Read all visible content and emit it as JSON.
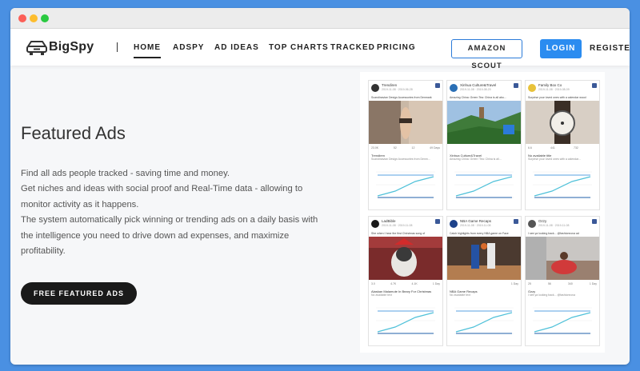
{
  "brand": {
    "name": "BigSpy"
  },
  "nav": {
    "items": [
      "HOME",
      "ADSPY",
      "AD IDEAS",
      "TOP CHARTS",
      "TRACKED",
      "PRICING"
    ],
    "active": "HOME",
    "amazon_label": "AMAZON SCOUT",
    "login_label": "LOGIN",
    "register_label": "REGISTER"
  },
  "hero": {
    "title": "Featured Ads",
    "desc": [
      "Find all ads people tracked - saving time and money.",
      "Get niches and ideas with social proof and Real-Time data - allowing to monitor activity as it happens.",
      "The system automatically pick winning or trending ads on a daily basis with the intelligence you need to drive down ad expenses, and maximize profitability."
    ],
    "cta_label": "FREE FEATURED ADS"
  },
  "cards": [
    {
      "name": "Trendiren",
      "date": "2019-11-08 · 2019-06-28",
      "caption": "Scandinavian Design Accessories from Denmark",
      "stats": [
        "23.0K",
        "52",
        "12",
        "49 Days"
      ],
      "title2": "Trendiren",
      "text2": "Scandinavian Design Accessories from Denm...",
      "scene": "bracelet",
      "av": "#333333"
    },
    {
      "name": "Xinhua Culture&Travel",
      "date": "2019-11-08 · 2019-08-20",
      "caption": "Amazing China: Green Tea: China is all abo...",
      "stats": [
        "",
        "",
        "",
        ""
      ],
      "title2": "Xinhua Culture&Travel",
      "text2": "Amazing China: Green 'Tea: China is all...",
      "scene": "tea",
      "av": "#2a6fb5"
    },
    {
      "name": "Family Box Co",
      "date": "2019-11-08 · 2019-08-09",
      "caption": "Surprise your loved ones with a calendar wood",
      "stats": [
        "6.6",
        "441",
        "732",
        ""
      ],
      "title2": "No available title",
      "text2": "Surprise your loved ones with a calendar...",
      "scene": "watch",
      "av": "#e8c23a"
    },
    {
      "name": "LadBible",
      "date": "2019-11-08 · 2019-11-08",
      "caption": "She when I hear the first Christmas song of",
      "stats": [
        "3.0",
        "4.7K",
        "4.1K",
        "1 Day"
      ],
      "title2": "Alaskan Malamute In Beary For Christmas",
      "text2": "No available text",
      "scene": "dog",
      "av": "#1a1a1a"
    },
    {
      "name": "NBA Game Recaps",
      "date": "2019-11-08 · 2019-11-08",
      "caption": "Catch highlights from every NBA game on Face",
      "stats": [
        "",
        "",
        "",
        "1 Day"
      ],
      "title2": "NBA Game Recaps",
      "text2": "No available text",
      "scene": "nba",
      "av": "#1d428a"
    },
    {
      "name": "Ozzy",
      "date": "2019-11-08 · 2019-11-08",
      "caption": "I see ya looking back... @fashionnova ad",
      "stats": [
        "25",
        "56",
        "340",
        "1 Day"
      ],
      "title2": "Ozzy",
      "text2": "I see ya looking back... @fashionnova",
      "scene": "room",
      "av": "#555555"
    }
  ],
  "colors": {
    "accent": "#2b8cf0",
    "dark": "#1a1a1a",
    "chart_teal": "#4fc1d9",
    "chart_navy": "#1f5fa8"
  }
}
